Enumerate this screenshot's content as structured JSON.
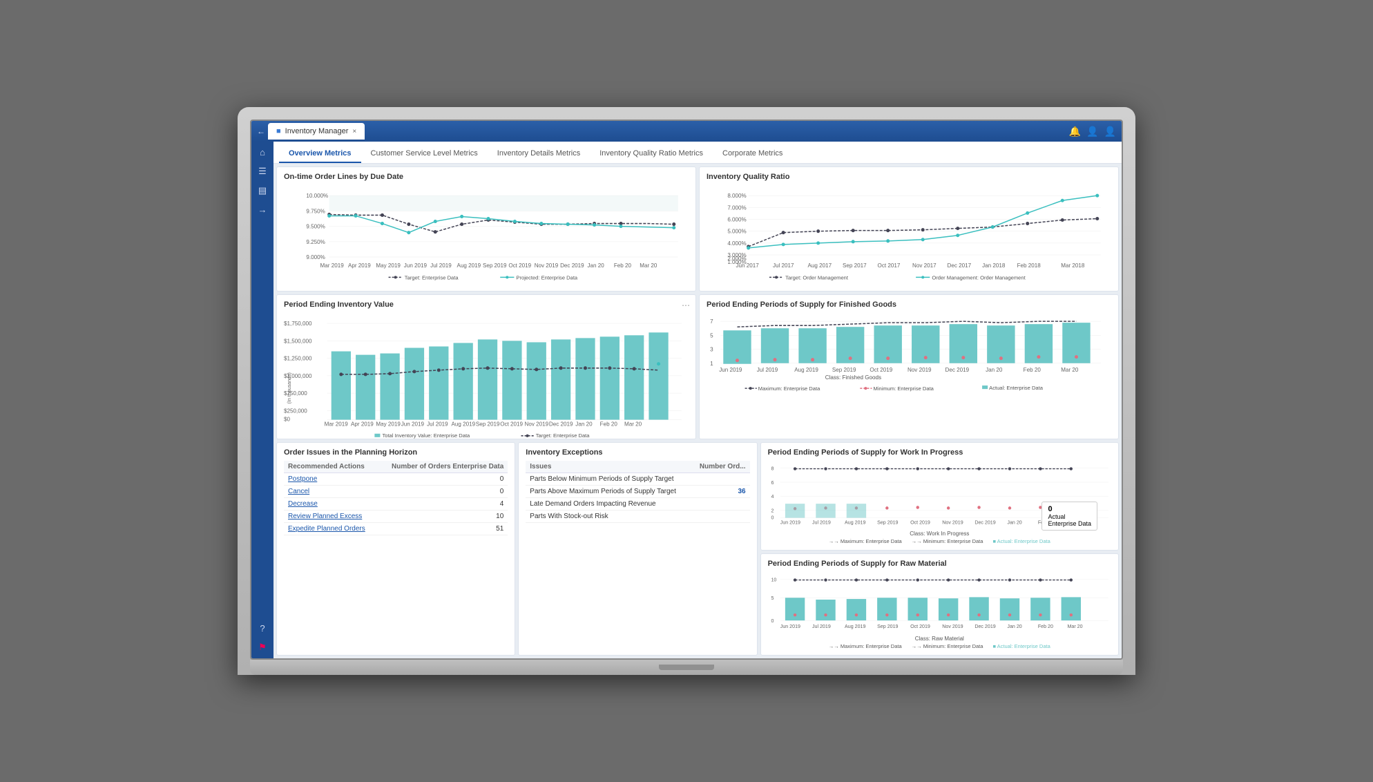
{
  "app": {
    "title": "Inventory Manager",
    "tab_close": "×"
  },
  "nav": {
    "tabs": [
      {
        "label": "Overview Metrics",
        "active": true
      },
      {
        "label": "Customer Service Level Metrics",
        "active": false
      },
      {
        "label": "Inventory Details Metrics",
        "active": false
      },
      {
        "label": "Inventory Quality Ratio Metrics",
        "active": false
      },
      {
        "label": "Corporate Metrics",
        "active": false
      }
    ]
  },
  "charts": {
    "on_time_title": "On-time Order Lines by Due Date",
    "inv_quality_title": "Inventory Quality Ratio",
    "period_inv_title": "Period Ending Inventory Value",
    "period_finished_title": "Period Ending Periods of Supply for Finished Goods",
    "period_wip_title": "Period Ending Periods of Supply for Work In Progress",
    "period_raw_title": "Period Ending Periods of Supply for Raw Material"
  },
  "order_issues": {
    "title": "Order Issues in the Planning Horizon",
    "col1": "Recommended Actions",
    "col2": "Number of Orders Enterprise Data",
    "rows": [
      {
        "action": "Postpone",
        "value": "0"
      },
      {
        "action": "Cancel",
        "value": "0"
      },
      {
        "action": "Decrease",
        "value": "4"
      },
      {
        "action": "Review Planned Excess",
        "value": "10"
      },
      {
        "action": "Expedite Planned Orders",
        "value": "51"
      }
    ]
  },
  "inv_exceptions": {
    "title": "Inventory Exceptions",
    "col1": "Issues",
    "col2": "Number Ord...",
    "rows": [
      {
        "issue": "Parts Below Minimum Periods of Supply Target",
        "value": ""
      },
      {
        "issue": "Parts Above Maximum Periods of Supply Target",
        "value": "36"
      },
      {
        "issue": "Late Demand Orders Impacting Revenue",
        "value": ""
      },
      {
        "issue": "Parts With Stock-out Risk",
        "value": ""
      }
    ]
  },
  "tooltip": {
    "value": "0",
    "label": "Actual",
    "sublabel": "Enterprise Data"
  },
  "xaxis_months_short": [
    "Mar 2019",
    "Apr 2019",
    "May 2019",
    "Jun 2019",
    "Jul 2019",
    "Aug 2019",
    "Sep 2019",
    "Oct 2019",
    "Nov 2019",
    "Dec 2019",
    "Jan 20",
    "Feb 20",
    "Mar 20"
  ],
  "xaxis_months_supply": [
    "Jun 2019",
    "Jul 2019",
    "Aug 2019",
    "Sep 2019",
    "Oct 2019",
    "Nov 2019",
    "Dec 2019",
    "Jan 20",
    "Feb 20",
    "Mar 20"
  ],
  "xaxis_months_quality": [
    "Jun 2017",
    "Jul 2017",
    "Aug 2017",
    "Sep 2017",
    "Oct 2017",
    "Nov 2017",
    "Dec 2017",
    "Jan 2018",
    "Feb 2018",
    "Mar 2018"
  ]
}
